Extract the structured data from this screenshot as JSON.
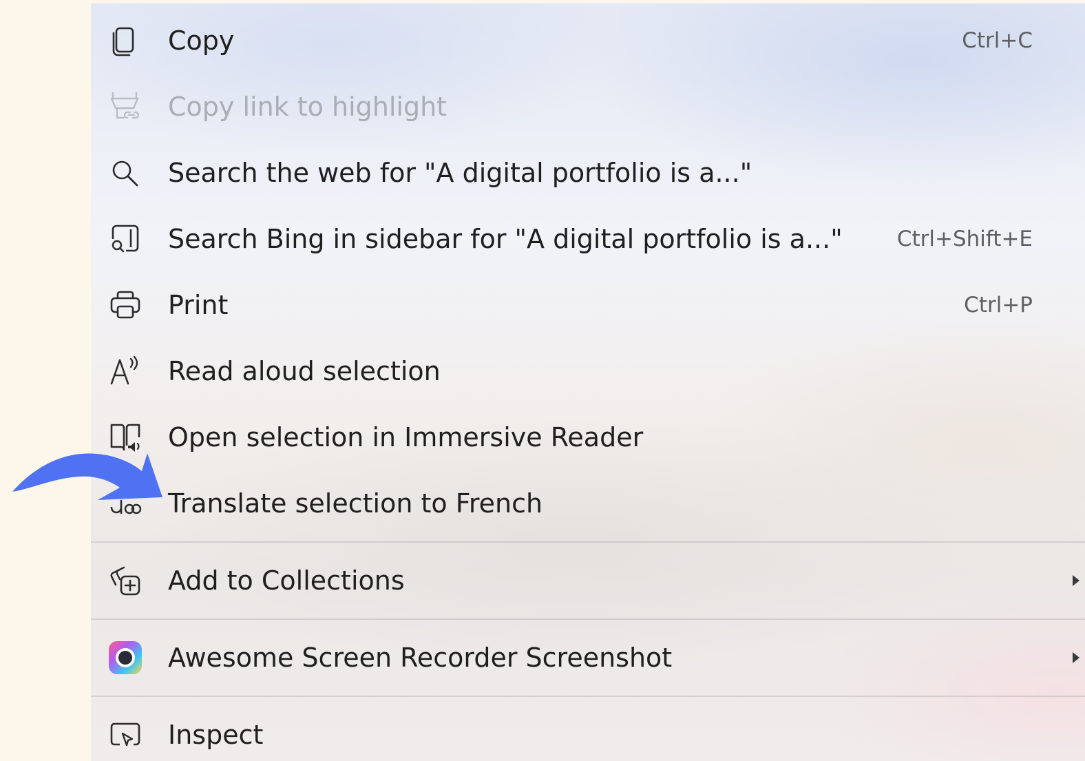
{
  "menu": {
    "copy": {
      "label": "Copy",
      "shortcut": "Ctrl+C",
      "icon": "copy-icon"
    },
    "copy_link": {
      "label": "Copy link to highlight",
      "icon": "link-highlight-icon"
    },
    "search_web": {
      "label": "Search the web for \"A digital portfolio is a...\"",
      "icon": "search-icon"
    },
    "search_bing": {
      "label": "Search Bing in sidebar for \"A digital portfolio is a...\"",
      "shortcut": "Ctrl+Shift+E",
      "icon": "sidebar-search-icon"
    },
    "print": {
      "label": "Print",
      "shortcut": "Ctrl+P",
      "icon": "printer-icon"
    },
    "read_aloud": {
      "label": "Read aloud selection",
      "icon": "read-aloud-icon"
    },
    "immersive_reader": {
      "label": "Open selection in Immersive Reader",
      "icon": "immersive-reader-icon"
    },
    "translate": {
      "label": "Translate selection to French",
      "icon": "translate-icon"
    },
    "collections": {
      "label": "Add to Collections",
      "icon": "collections-add-icon"
    },
    "screen_recorder": {
      "label": "Awesome Screen Recorder  Screenshot",
      "icon": "screen-recorder-icon"
    },
    "inspect": {
      "label": "Inspect",
      "icon": "inspect-icon"
    }
  },
  "colors": {
    "page_background": "#fdf6ea",
    "arrow": "#4f72f2",
    "disabled_text": "#a9aeb6",
    "text": "#1f1f1f",
    "shortcut_text": "#5f5f5f"
  }
}
